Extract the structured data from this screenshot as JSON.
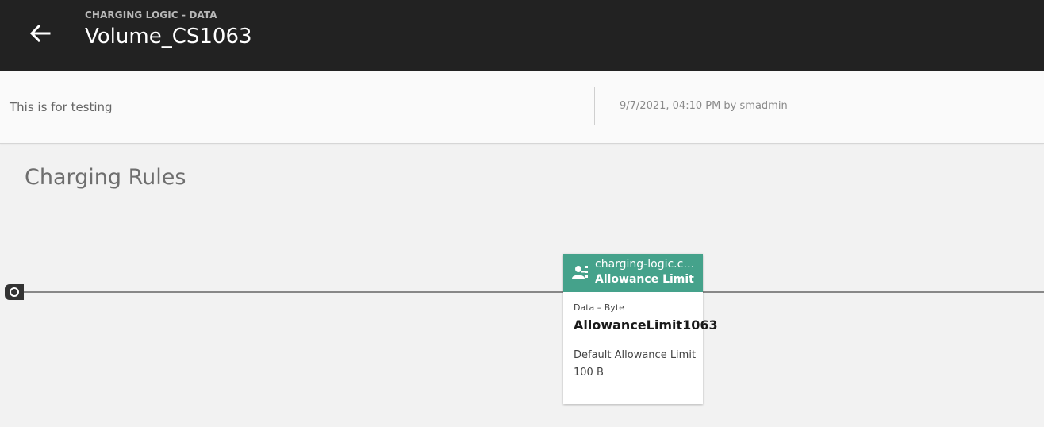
{
  "header": {
    "subtitle": "CHARGING LOGIC - DATA",
    "title": "Volume_CS1063",
    "back_icon": "arrow-left-icon"
  },
  "info": {
    "description": "This is for testing",
    "modified": "9/7/2021, 04:10 PM by smadmin"
  },
  "section": {
    "title": "Charging Rules"
  },
  "flow": {
    "start_icon": "circle-start-icon",
    "line_color": "#888888"
  },
  "rule_card": {
    "header_color": "#45a28b",
    "icon": "user-rule-icon",
    "reference": "charging-logic.ch...",
    "type": "Allowance Limit",
    "category": "Data – Byte",
    "name": "AllowanceLimit1063",
    "param_label": "Default Allowance Limit",
    "param_value": "100 B"
  }
}
